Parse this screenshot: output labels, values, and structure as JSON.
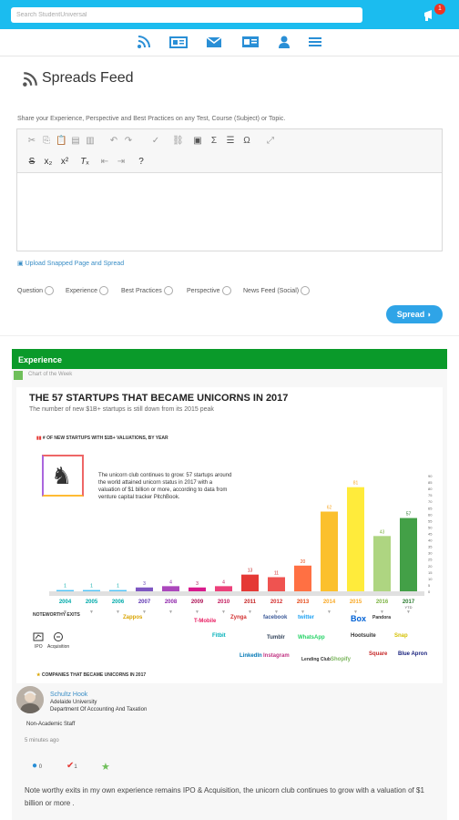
{
  "topbar": {
    "search_placeholder": "Search StudentUniversal",
    "notification_count": "1"
  },
  "nav": {
    "icons": [
      "rss-icon",
      "news-icon",
      "mail-icon",
      "id-card-icon",
      "user-icon",
      "menu-icon"
    ]
  },
  "feed": {
    "title": "Spreads Feed",
    "prompt": "Share your Experience, Perspective and Best Practices on any Test, Course (Subject) or Topic.",
    "upload_label": "Upload Snapped Page and Spread",
    "categories": [
      "Question",
      "Experience",
      "Best Practices",
      "Perspective",
      "News Feed (Social)"
    ],
    "spread_button": "Spread"
  },
  "post": {
    "category": "Experience",
    "sub_label": "Chart of the Week",
    "infographic": {
      "title": "THE 57 STARTUPS THAT BECAME UNICORNS IN 2017",
      "subtitle": "The number of new $1B+ startups is still down from its 2015 peak",
      "section_label": "# OF NEW STARTUPS WITH $1B+ VALUATIONS, BY YEAR",
      "callout": "The unicorn club continues to grow: 57 startups around the world attained unicorn status in 2017 with a valuation of $1 billion or more, according to data from venture capital tracker PitchBook.",
      "exits_label": "NOTEWORTHY EXITS",
      "ipo_label": "IPO",
      "acquisition_label": "Acquisition",
      "companies_label": "COMPANIES THAT BECAME UNICORNS IN 2017",
      "ytd_label": "YTD",
      "logos": [
        "Zappos",
        "T-Mobile",
        "Zynga",
        "facebook",
        "twitter",
        "Box",
        "Instagram",
        "LinkedIn",
        "Shopify",
        "Hootsuite",
        "Tumblr",
        "Pandora",
        "WhatsApp",
        "Square",
        "Snap",
        "Blue Apron",
        "Lending Club",
        "Fitbit"
      ]
    },
    "chart_data": {
      "type": "bar",
      "categories": [
        "2004",
        "2005",
        "2006",
        "2007",
        "2008",
        "2009",
        "2010",
        "2011",
        "2012",
        "2013",
        "2014",
        "2015",
        "2016",
        "2017"
      ],
      "values": [
        1,
        1,
        1,
        3,
        4,
        3,
        4,
        13,
        11,
        20,
        62,
        81,
        43,
        57
      ],
      "ylim": [
        0,
        90
      ],
      "yticks": [
        0,
        5,
        10,
        15,
        20,
        25,
        30,
        35,
        40,
        45,
        50,
        55,
        60,
        65,
        70,
        75,
        80,
        85,
        90
      ],
      "colors": [
        "#4fc3f7",
        "#4fc3f7",
        "#4fc3f7",
        "#7e57c2",
        "#ab47bc",
        "#d81b8c",
        "#ec407a",
        "#e53935",
        "#ef5350",
        "#ff7043",
        "#fbc02d",
        "#ffeb3b",
        "#aed581",
        "#43a047"
      ],
      "label_colors": [
        "#0aa",
        "#0aa",
        "#0aa",
        "#5e35b1",
        "#8e24aa",
        "#ad1457",
        "#c2185b",
        "#c62828",
        "#d32f2f",
        "#e64a19",
        "#f9a825",
        "#f9a825",
        "#7cb342",
        "#2e7d32"
      ]
    },
    "author": {
      "name": "Schultz Hook",
      "university": "Adelaide University",
      "department": "Department Of Accounting And Taxation",
      "role": "Non-Academic Staff"
    },
    "time": "5 minutes ago",
    "comments": "0",
    "likes": "1",
    "text": "Note worthy exits in my own experience remains IPO & Acquisition, the unicorn club continues to grow with a valuation of $1 billion or more ."
  }
}
